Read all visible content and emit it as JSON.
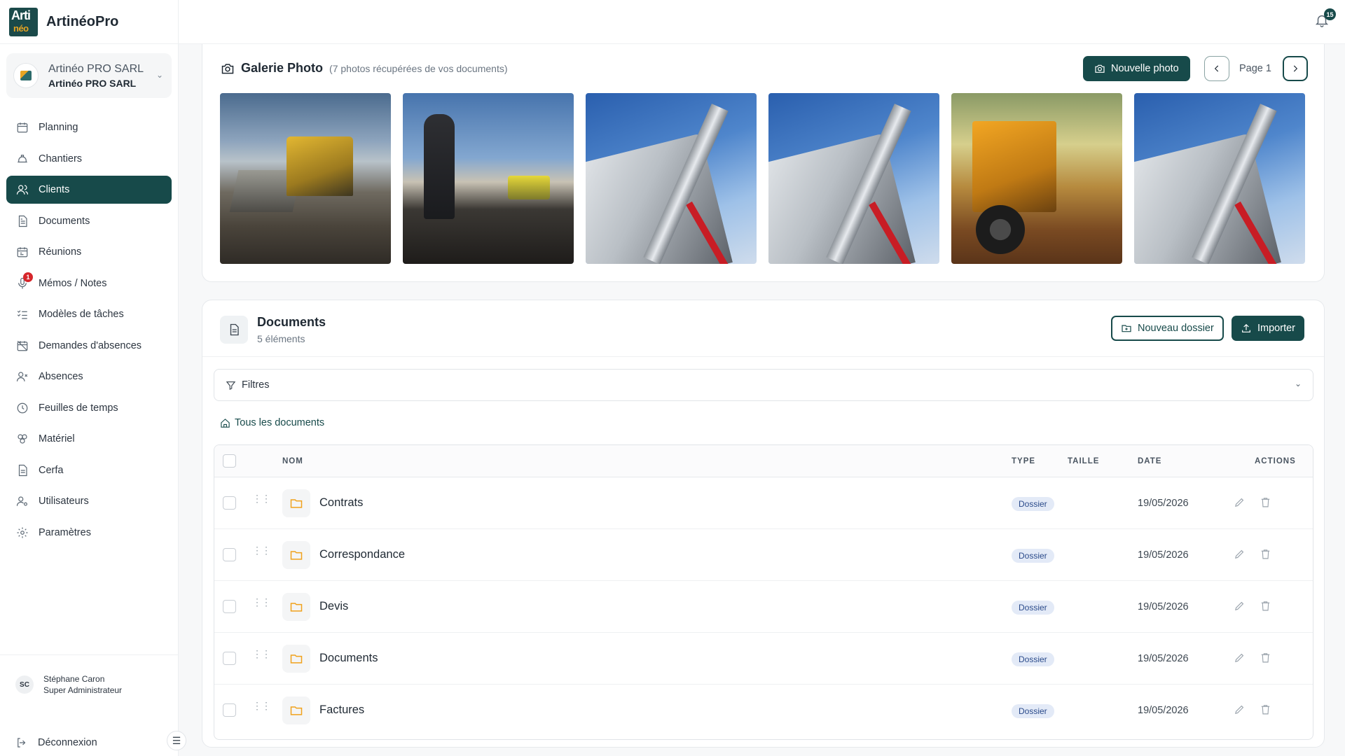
{
  "app": {
    "brand_name": "ArtinéoPro",
    "logo_text_top": "Arti",
    "logo_text_bottom": "néo",
    "company_name": "Artinéo PRO SARL",
    "company_legal": "Artinéo PRO SARL",
    "notifications_count": "15"
  },
  "sidebar": {
    "items": [
      {
        "label": "Planning",
        "icon": "calendar-icon"
      },
      {
        "label": "Chantiers",
        "icon": "hard-hat-icon"
      },
      {
        "label": "Clients",
        "icon": "users-icon",
        "active": true
      },
      {
        "label": "Documents",
        "icon": "document-icon"
      },
      {
        "label": "Réunions",
        "icon": "calendar-meeting-icon"
      },
      {
        "label": "Mémos / Notes",
        "icon": "microphone-icon",
        "badge": "1"
      },
      {
        "label": "Modèles de tâches",
        "icon": "checklist-icon"
      },
      {
        "label": "Demandes d'absences",
        "icon": "calendar-off-icon"
      },
      {
        "label": "Absences",
        "icon": "user-x-icon"
      },
      {
        "label": "Feuilles de temps",
        "icon": "clock-icon"
      },
      {
        "label": "Matériel",
        "icon": "tools-icon"
      },
      {
        "label": "Cerfa",
        "icon": "file-text-icon"
      },
      {
        "label": "Utilisateurs",
        "icon": "user-key-icon"
      },
      {
        "label": "Paramètres",
        "icon": "gear-icon"
      }
    ],
    "user": {
      "initials": "SC",
      "name": "Stéphane Caron",
      "role": "Super Administrateur"
    },
    "logout_label": "Déconnexion"
  },
  "gallery": {
    "title": "Galerie Photo",
    "subtitle": "(7 photos récupérées de vos documents)",
    "new_photo_label": "Nouvelle photo",
    "page_label": "Page 1",
    "photos": [
      "bulldozer",
      "road-workers",
      "crane",
      "crane",
      "loader",
      "crane"
    ]
  },
  "documents": {
    "title": "Documents",
    "count_label": "5 éléments",
    "new_folder_label": "Nouveau dossier",
    "import_label": "Importer",
    "filters_label": "Filtres",
    "breadcrumb_label": "Tous les documents",
    "columns": {
      "name": "NOM",
      "type": "TYPE",
      "size": "TAILLE",
      "date": "DATE",
      "actions": "ACTIONS"
    },
    "rows": [
      {
        "name": "Contrats",
        "type": "Dossier",
        "size": "",
        "date": "19/05/2026"
      },
      {
        "name": "Correspondance",
        "type": "Dossier",
        "size": "",
        "date": "19/05/2026"
      },
      {
        "name": "Devis",
        "type": "Dossier",
        "size": "",
        "date": "19/05/2026"
      },
      {
        "name": "Documents",
        "type": "Dossier",
        "size": "",
        "date": "19/05/2026"
      },
      {
        "name": "Factures",
        "type": "Dossier",
        "size": "",
        "date": "19/05/2026"
      }
    ]
  },
  "colors": {
    "primary": "#174a4a",
    "folder": "#f0a21c",
    "badge_red": "#d6262b",
    "type_badge_bg": "#e3eaf7"
  }
}
